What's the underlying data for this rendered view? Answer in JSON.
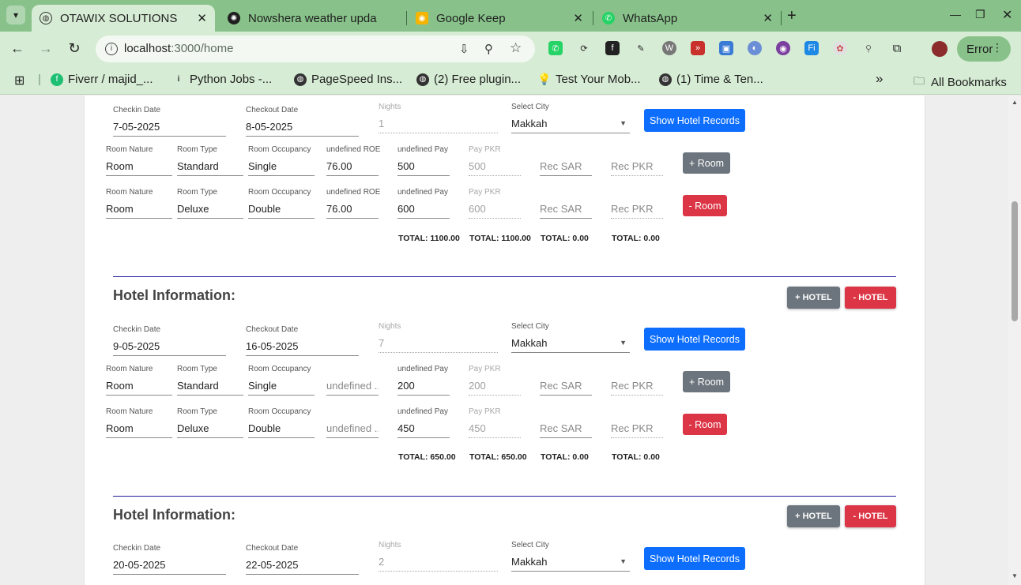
{
  "browser": {
    "tabs": [
      {
        "title": "OTAWIX SOLUTIONS",
        "active": true,
        "icon": "globe-icon"
      },
      {
        "title": "Nowshera weather upda",
        "active": false,
        "icon": "openai-icon"
      },
      {
        "title": "Google Keep",
        "active": false,
        "icon": "keep-icon"
      },
      {
        "title": "WhatsApp",
        "active": false,
        "icon": "whatsapp-icon"
      }
    ],
    "url_host": "localhost",
    "url_path": ":3000/home",
    "profile_status": "Error",
    "bookmarks": [
      {
        "label": "Fiverr / majid_...",
        "icon": "fiverr-icon"
      },
      {
        "label": "Python Jobs -...",
        "icon": "info-icon"
      },
      {
        "label": "PageSpeed Ins...",
        "icon": "globe-icon"
      },
      {
        "label": "(2) Free plugin...",
        "icon": "globe-icon"
      },
      {
        "label": "Test Your Mob...",
        "icon": "bulb-icon"
      },
      {
        "label": "(1) Time & Ten...",
        "icon": "globe-icon"
      }
    ],
    "all_bookmarks": "All Bookmarks"
  },
  "labels": {
    "checkin": "Checkin Date",
    "checkout": "Checkout Date",
    "nights": "Nights",
    "city": "Select City",
    "show_records": "Show Hotel Records",
    "room_nature": "Room Nature",
    "room_type": "Room Type",
    "room_occupancy": "Room Occupancy",
    "roe": "undefined ROE",
    "pay": "undefined Pay",
    "pay_pkr": "Pay PKR",
    "rec_sar": "Rec SAR",
    "rec_pkr": "Rec PKR",
    "add_room": "+ Room",
    "remove_room": "- Room",
    "hotel_info": "Hotel Information:",
    "add_hotel": "+ HOTEL",
    "remove_hotel": "- HOTEL"
  },
  "hotels": [
    {
      "checkin": "7-05-2025",
      "checkout": "8-05-2025",
      "nights": "1",
      "city": "Makkah",
      "rooms": [
        {
          "nature": "Room",
          "type": "Standard",
          "occupancy": "Single",
          "roe": "76.00",
          "pay": "500",
          "pay_pkr": "500"
        },
        {
          "nature": "Room",
          "type": "Deluxe",
          "occupancy": "Double",
          "roe": "76.00",
          "pay": "600",
          "pay_pkr": "600"
        }
      ],
      "totals": {
        "pay": "TOTAL: 1100.00",
        "pay_pkr": "TOTAL: 1100.00",
        "rec_sar": "TOTAL: 0.00",
        "rec_pkr": "TOTAL: 0.00"
      }
    },
    {
      "checkin": "9-05-2025",
      "checkout": "16-05-2025",
      "nights": "7",
      "city": "Makkah",
      "rooms": [
        {
          "nature": "Room",
          "type": "Standard",
          "occupancy": "Single",
          "roe": "undefined ...",
          "pay": "200",
          "pay_pkr": "200"
        },
        {
          "nature": "Room",
          "type": "Deluxe",
          "occupancy": "Double",
          "roe": "undefined ...",
          "pay": "450",
          "pay_pkr": "450"
        }
      ],
      "totals": {
        "pay": "TOTAL: 650.00",
        "pay_pkr": "TOTAL: 650.00",
        "rec_sar": "TOTAL: 0.00",
        "rec_pkr": "TOTAL: 0.00"
      }
    },
    {
      "checkin": "20-05-2025",
      "checkout": "22-05-2025",
      "nights": "2",
      "city": "Makkah"
    }
  ],
  "colors": {
    "primary": "#0d6efd",
    "secondary": "#6c757d",
    "danger": "#dc3545",
    "chrome": "#88c28a",
    "divider": "#1c1c9a"
  }
}
